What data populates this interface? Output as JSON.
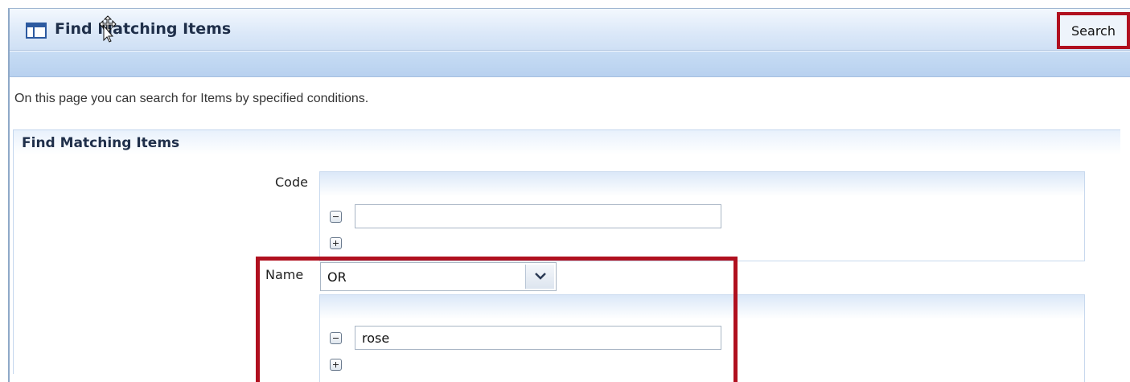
{
  "window": {
    "title": "Find Matching Items",
    "icon": "window-icon",
    "cursor_icon": "move-cursor-icon"
  },
  "toolbar": {
    "search_label": "Search"
  },
  "page": {
    "description": "On this page you can search for Items by specified conditions."
  },
  "section": {
    "title": "Find Matching Items",
    "fields": {
      "code": {
        "label": "Code",
        "values": [
          ""
        ],
        "remove_icon": "minus-icon",
        "add_icon": "plus-icon"
      },
      "name": {
        "label": "Name",
        "operator": "OR",
        "values": [
          "rose"
        ],
        "remove_icon": "minus-icon",
        "add_icon": "plus-icon"
      }
    }
  },
  "colors": {
    "highlight": "#b0101f",
    "header_gradient": "#cfe0f5",
    "accent_icon": "#2d5aa0"
  }
}
